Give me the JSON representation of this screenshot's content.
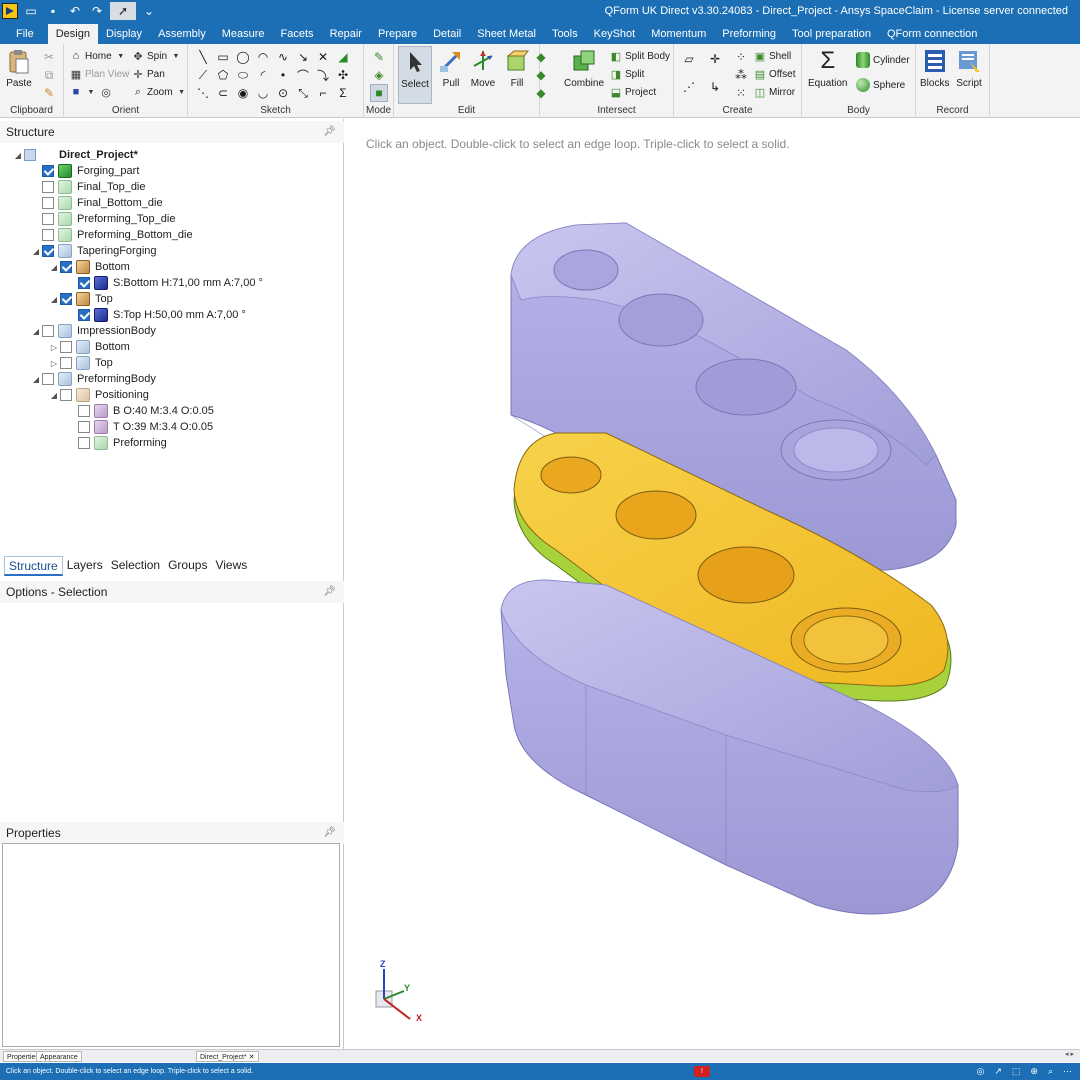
{
  "titlebar": {
    "title": "QForm UK Direct v3.30.24083 - Direct_Project - Ansys SpaceClaim - License server connected",
    "quick_access": [
      "open-icon",
      "save-icon",
      "undo-icon",
      "redo-icon",
      "select-tool-icon",
      "customize-icon"
    ]
  },
  "menu": {
    "tabs": [
      "File",
      "Design",
      "Display",
      "Assembly",
      "Measure",
      "Facets",
      "Repair",
      "Prepare",
      "Detail",
      "Sheet Metal",
      "Tools",
      "KeyShot",
      "Momentum",
      "Preforming",
      "Tool preparation",
      "QForm connection"
    ],
    "active": "Design"
  },
  "ribbon": {
    "clipboard": {
      "label": "Clipboard",
      "paste": "Paste"
    },
    "orient": {
      "label": "Orient",
      "home": "Home",
      "spin": "Spin",
      "plan_view": "Plan View",
      "pan": "Pan",
      "zoom": "Zoom"
    },
    "sketch": {
      "label": "Sketch"
    },
    "mode": {
      "label": "Mode"
    },
    "edit": {
      "label": "Edit",
      "select": "Select",
      "pull": "Pull",
      "move": "Move",
      "fill": "Fill"
    },
    "intersect": {
      "label": "Intersect",
      "combine": "Combine",
      "split_body": "Split Body",
      "split": "Split",
      "project": "Project"
    },
    "create": {
      "label": "Create",
      "shell": "Shell",
      "offset": "Offset",
      "mirror": "Mirror"
    },
    "body": {
      "label": "Body",
      "equation": "Equation",
      "cylinder": "Cylinder",
      "sphere": "Sphere"
    },
    "record": {
      "label": "Record",
      "blocks": "Blocks",
      "script": "Script"
    }
  },
  "structure": {
    "header": "Structure",
    "tree": [
      {
        "label": "Direct_Project*",
        "bold": true,
        "icon": "project",
        "checked": "partial",
        "expander": "open"
      },
      {
        "label": "Forging_part",
        "icon": "green",
        "checked": "on"
      },
      {
        "label": "Final_Top_die",
        "icon": "pale",
        "checked": "off"
      },
      {
        "label": "Final_Bottom_die",
        "icon": "pale",
        "checked": "off"
      },
      {
        "label": "Preforming_Top_die",
        "icon": "pale",
        "checked": "off"
      },
      {
        "label": "Preforming_Bottom_die",
        "icon": "pale",
        "checked": "off"
      },
      {
        "label": "TaperingForging",
        "icon": "stack",
        "checked": "on",
        "expander": "open"
      },
      {
        "label": "Bottom",
        "icon": "box",
        "checked": "on",
        "expander": "open"
      },
      {
        "label": "S:Bottom H:71,00 mm A:7,00 °",
        "icon": "blue",
        "checked": "on"
      },
      {
        "label": "Top",
        "icon": "box",
        "checked": "on",
        "expander": "open"
      },
      {
        "label": "S:Top H:50,00 mm A:7,00 °",
        "icon": "blue",
        "checked": "on"
      },
      {
        "label": "ImpressionBody",
        "icon": "stack",
        "checked": "off",
        "expander": "open"
      },
      {
        "label": "Bottom",
        "icon": "stack",
        "checked": "off",
        "expander": "closed"
      },
      {
        "label": "Top",
        "icon": "stack",
        "checked": "off",
        "expander": "closed"
      },
      {
        "label": "PreformingBody",
        "icon": "stack",
        "checked": "off",
        "expander": "open"
      },
      {
        "label": "Positioning",
        "icon": "boxp",
        "checked": "off",
        "expander": "open"
      },
      {
        "label": "B O:40 M:3.4 O:0.05",
        "icon": "purp",
        "checked": "off"
      },
      {
        "label": "T O:39 M:3.4 O:0.05",
        "icon": "purp",
        "checked": "off"
      },
      {
        "label": "Preforming",
        "icon": "pale",
        "checked": "off"
      }
    ]
  },
  "panel_tabs": [
    "Structure",
    "Layers",
    "Selection",
    "Groups",
    "Views"
  ],
  "options": {
    "header": "Options - Selection"
  },
  "properties": {
    "header": "Properties"
  },
  "viewport": {
    "hint": "Click an object. Double-click to select an edge loop. Triple-click to select a solid.",
    "axes": {
      "z": "Z",
      "y": "Y",
      "x": "X"
    },
    "colors": {
      "die": "#b3b0e6",
      "part_top": "#f5c530",
      "part_bottom": "#a7d23c"
    }
  },
  "doc_tabs": {
    "left": [
      "Properties",
      "Appearance"
    ],
    "document": "Direct_Project*"
  },
  "status": {
    "text": "Click an object. Double-click to select an edge loop. Triple-click to select a solid.",
    "error_badge": "!"
  }
}
